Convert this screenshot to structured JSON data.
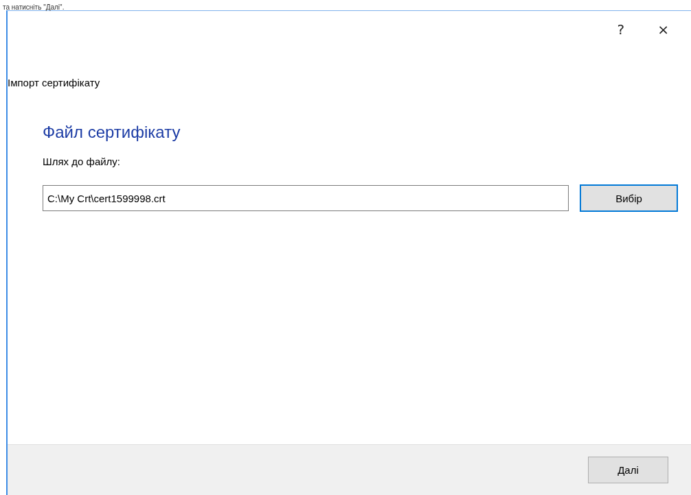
{
  "background_text": "та натисніть \"Далі\".",
  "dialog": {
    "help_button": "?",
    "close_button": "×",
    "title": "Імпорт сертифікату",
    "heading": "Файл сертифікату",
    "path_label": "Шлях до файлу:",
    "path_field": {
      "value": "C:\\My Crt\\cert1599998.crt"
    },
    "browse_button": {
      "label": "Вибір",
      "focused": true
    },
    "next_button": {
      "label": "Далі",
      "focused": false
    }
  }
}
